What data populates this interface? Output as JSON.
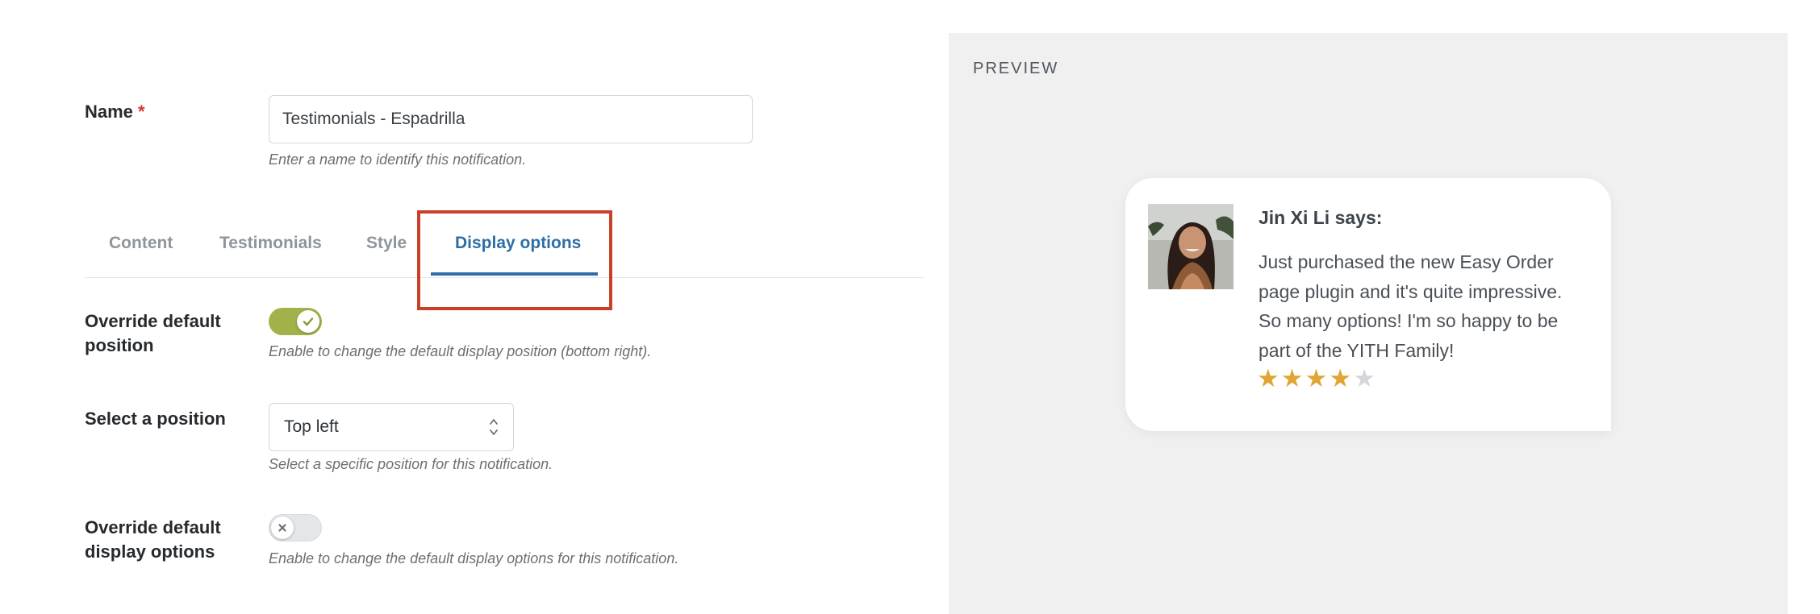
{
  "form": {
    "name_label": "Name",
    "required_mark": "*",
    "name_value": "Testimonials - Espadrilla",
    "name_hint": "Enter a name to identify this notification.",
    "tabs": [
      {
        "label": "Content",
        "active": false
      },
      {
        "label": "Testimonials",
        "active": false
      },
      {
        "label": "Style",
        "active": false
      },
      {
        "label": "Display options",
        "active": true
      }
    ],
    "override_position": {
      "label_line1": "Override default",
      "label_line2": "position",
      "enabled": true,
      "hint": "Enable to change the default display position (bottom right)."
    },
    "position_select": {
      "label": "Select a position",
      "value": "Top left",
      "hint": "Select a specific position for this notification."
    },
    "override_display": {
      "label_line1": "Override default",
      "label_line2": "display options",
      "enabled": false,
      "hint": "Enable to change the default display options for this notification."
    }
  },
  "preview": {
    "title": "PREVIEW",
    "card": {
      "author": "Jin Xi Li says:",
      "text": "Just purchased the new Easy Order page plugin and it's quite impressive. So many options! I'm so happy to be part of the YITH Family!",
      "rating": 4,
      "rating_max": 5
    }
  },
  "colors": {
    "accent": "#2f6ea5",
    "toggle_on": "#a2b14a",
    "highlight": "#c9402a",
    "star": "#e0a532"
  },
  "icons": {
    "toggle_on": "check-icon",
    "toggle_off": "x-icon",
    "select": "chevron-up-down-icon"
  }
}
